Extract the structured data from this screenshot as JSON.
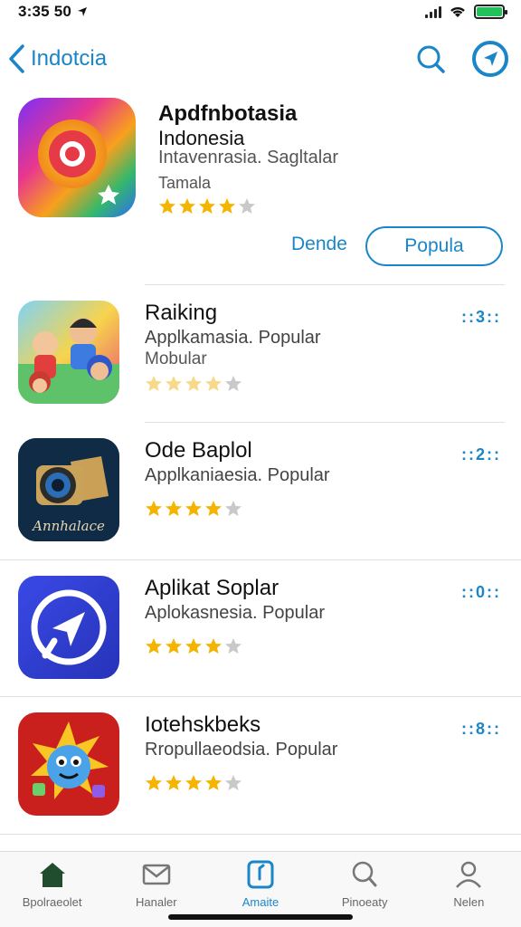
{
  "status_bar": {
    "time": "3:35 50",
    "location_arrow": "location-arrow-icon"
  },
  "nav": {
    "back_label": "Indotcia"
  },
  "featured": {
    "title": "Apdfnbotasia",
    "subtitle": "Indonesia",
    "description": "Intavenrasia. Sagltalar",
    "category": "Tamala",
    "rating": 4,
    "link_label": "Dende",
    "pill_label": "Popula"
  },
  "apps": [
    {
      "name": "Raiking",
      "subtitle": "Applkamasia. Popular",
      "subtitle2": "Mobular",
      "rating": 4,
      "more": "::3::"
    },
    {
      "name": "Ode Baplol",
      "subtitle": "Applkaniaesia. Popular",
      "subtitle2": "",
      "rating": 4,
      "more": "::2::"
    },
    {
      "name": "Aplikat Soplar",
      "subtitle": "Aplokasnesia. Popular",
      "subtitle2": "",
      "rating": 4,
      "more": "::0::"
    },
    {
      "name": "Iotehskbeks",
      "subtitle": "Rropullaeodsia. Popular",
      "subtitle2": "",
      "rating": 4,
      "more": "::8::"
    }
  ],
  "icon_labels": {
    "app2": "Annhalace"
  },
  "tabs": [
    {
      "label": "Bpolraeolet",
      "icon": "home-icon"
    },
    {
      "label": "Hanaler",
      "icon": "mail-icon"
    },
    {
      "label": "Amaite",
      "icon": "apps-icon"
    },
    {
      "label": "Pinoeaty",
      "icon": "search-icon"
    },
    {
      "label": "Nelen",
      "icon": "person-icon"
    }
  ],
  "colors": {
    "accent": "#1a86c8",
    "star": "#f4b400"
  }
}
